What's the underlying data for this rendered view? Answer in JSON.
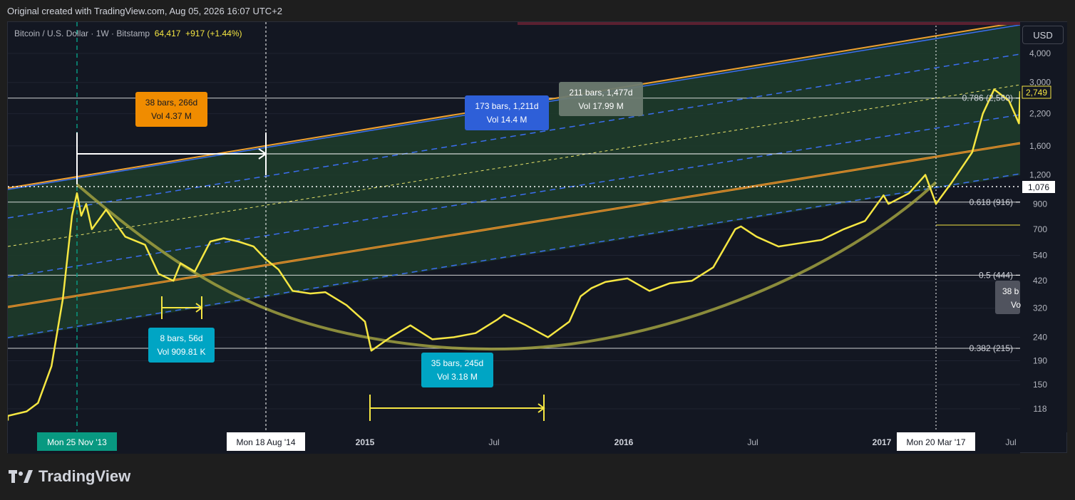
{
  "header": {
    "credit": "Original created with TradingView.com, Aug 05, 2026 16:07 UTC+2"
  },
  "symbol": {
    "name": "Bitcoin / U.S. Dollar · 1W · Bitstamp",
    "price": "64,417",
    "change": "+917 (+1.44%)"
  },
  "currency": "USD",
  "footer": {
    "brand": "TradingView"
  },
  "colors": {
    "background": "#131722",
    "price_line": "#f5e642",
    "channel_fill": "#1e3d2a",
    "orange": "#f0a030",
    "blue": "#3b6ef0",
    "teal": "#089981",
    "cyan_label": "#00a5c4",
    "orange_label": "#f08c00"
  },
  "chart_data": {
    "type": "line",
    "scale": "log",
    "ylim": [
      100,
      5000
    ],
    "yticks": [
      118,
      150,
      190,
      240,
      320,
      420,
      540,
      700,
      900,
      1200,
      1600,
      2200,
      3000,
      4000
    ],
    "xticks": [
      "Mon 25 Nov '13",
      "Mon 18 Aug '14",
      "2015",
      "Jul",
      "2016",
      "Jul",
      "2017",
      "Mon 20 Mar '17",
      "Jul"
    ],
    "price_labels": {
      "current": "2,749",
      "crosshair": "1,076"
    },
    "fib_levels": [
      {
        "label": "0.786 (2,569)",
        "value": 2569
      },
      {
        "label": "0.618 (916)",
        "value": 916
      },
      {
        "label": "0.5 (444)",
        "value": 444
      },
      {
        "label": "0.382 (215)",
        "value": 215
      }
    ],
    "measure_labels": [
      {
        "line1": "38 bars, 266d",
        "line2": "Vol 4.37 M"
      },
      {
        "line1": "173 bars, 1,211d",
        "line2": "Vol 14.4 M"
      },
      {
        "line1": "211 bars, 1,477d",
        "line2": "Vol 17.99 M"
      },
      {
        "line1": "8 bars, 56d",
        "line2": "Vol 909.81 K"
      },
      {
        "line1": "35 bars, 245d",
        "line2": "Vol 3.18 M"
      },
      {
        "line1": "38 b",
        "line2": "Vo"
      }
    ],
    "series": [
      {
        "x": [
          "2013-07-15",
          "2013-08-15",
          "2013-09-15",
          "2013-10-01",
          "2013-10-20",
          "2013-11-05",
          "2013-11-18",
          "2013-11-25",
          "2013-12-01",
          "2013-12-08",
          "2013-12-16",
          "2014-01-05",
          "2014-02-01",
          "2014-03-01",
          "2014-03-20",
          "2014-04-10",
          "2014-04-20",
          "2014-05-10",
          "2014-06-01",
          "2014-06-20",
          "2014-07-10",
          "2014-08-01",
          "2014-08-18",
          "2014-09-05",
          "2014-09-25",
          "2014-10-20",
          "2014-11-10",
          "2014-12-10",
          "2015-01-05",
          "2015-01-14",
          "2015-02-10",
          "2015-03-10",
          "2015-04-10",
          "2015-05-10",
          "2015-06-10",
          "2015-07-10",
          "2015-07-20",
          "2015-08-20",
          "2015-09-20",
          "2015-10-20",
          "2015-11-05",
          "2015-11-20",
          "2015-12-10",
          "2016-01-10",
          "2016-02-10",
          "2016-03-10",
          "2016-04-10",
          "2016-05-10",
          "2016-06-10",
          "2016-06-18",
          "2016-07-10",
          "2016-08-10",
          "2016-09-10",
          "2016-10-10",
          "2016-11-10",
          "2016-12-10",
          "2017-01-05",
          "2017-01-12",
          "2017-02-10",
          "2017-03-05",
          "2017-03-20",
          "2017-04-10",
          "2017-05-10",
          "2017-05-25",
          "2017-06-10",
          "2017-07-01",
          "2017-07-15",
          "2017-07-25"
        ],
        "values": [
          105,
          110,
          115,
          125,
          180,
          350,
          800,
          1000,
          800,
          900,
          700,
          850,
          650,
          600,
          450,
          420,
          500,
          460,
          620,
          640,
          620,
          590,
          520,
          470,
          380,
          370,
          375,
          330,
          280,
          210,
          240,
          270,
          235,
          240,
          250,
          285,
          300,
          270,
          240,
          280,
          360,
          390,
          415,
          430,
          380,
          410,
          420,
          480,
          700,
          720,
          650,
          590,
          610,
          630,
          700,
          760,
          980,
          900,
          1000,
          1200,
          900,
          1100,
          1500,
          2200,
          2800,
          2500,
          2000,
          2749
        ]
      }
    ]
  }
}
